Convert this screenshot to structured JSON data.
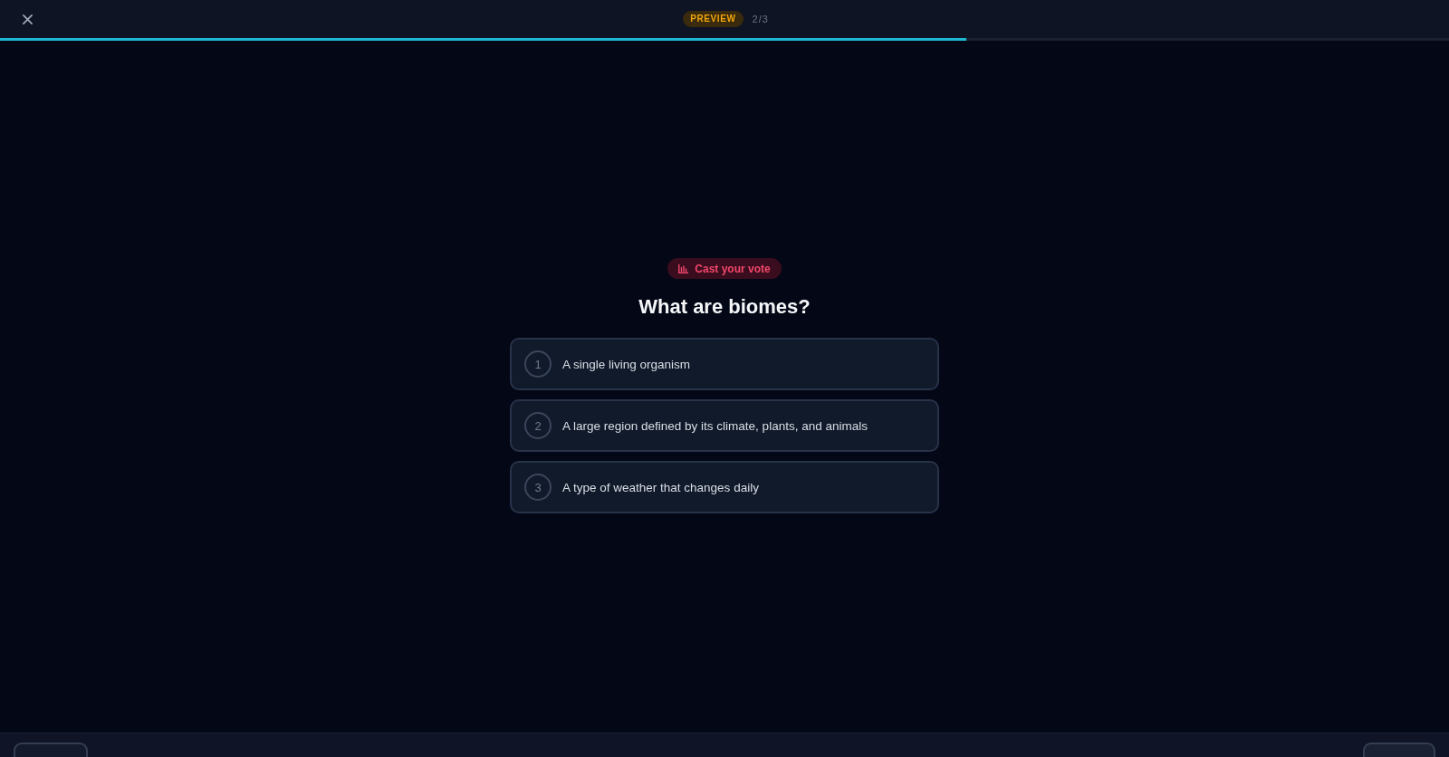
{
  "header": {
    "badge": "PREVIEW",
    "counter": "2/3",
    "progress": {
      "level": 0.667
    }
  },
  "prompt": {
    "badge": "Cast your vote",
    "question": "What are biomes?"
  },
  "options": [
    {
      "number": "1",
      "text": "A single living organism",
      "selected": false
    },
    {
      "number": "2",
      "text": "A large region defined by its climate, plants, and animals",
      "selected": false
    },
    {
      "number": "3",
      "text": "A type of weather that changes daily",
      "selected": false
    }
  ]
}
